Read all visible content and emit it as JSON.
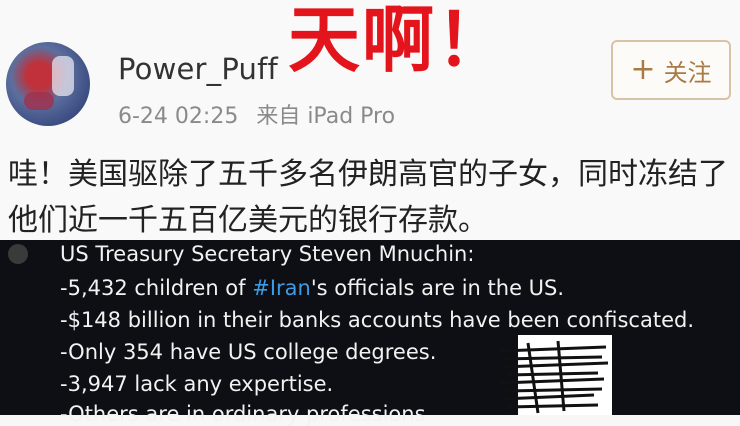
{
  "post": {
    "username": "Power_Puff",
    "timestamp": "6-24 02:25",
    "source": "来自 iPad Pro",
    "overlay_text": "天啊！",
    "follow_label": "关注",
    "text": "哇！美国驱除了五千多名伊朗高官的子女，同时冻结了他们近一千五百亿美元的银行存款。"
  },
  "quote": {
    "line1": "US Treasury Secretary Steven Mnuchin:",
    "line2_pre": "-5,432 children of ",
    "line2_tag": "#Iran",
    "line2_post": "'s officials are in the US.",
    "line3": "-$148 billion in their banks accounts have been confiscated.",
    "line4": "-Only 354 have US college degrees.",
    "line5": "-3,947 lack any expertise.",
    "line6": "-Others are in ordinary professions"
  }
}
